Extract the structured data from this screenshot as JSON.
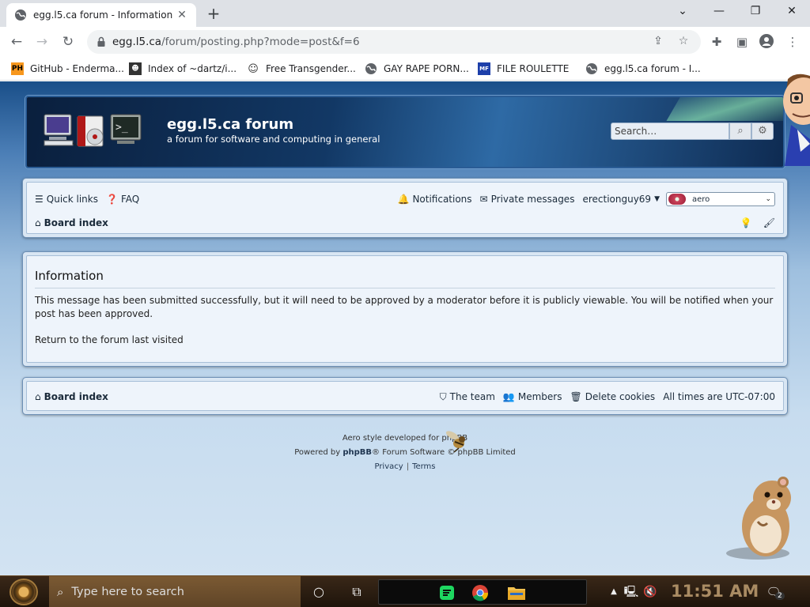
{
  "browser": {
    "tab_title": "egg.l5.ca forum - Information",
    "url_host": "egg.l5.ca",
    "url_path": "/forum/posting.php?mode=post&f=6",
    "bookmarks": [
      {
        "label": "GitHub - Enderma...",
        "icon": "PH"
      },
      {
        "label": "Index of ~dartz/i...",
        "icon": "cat"
      },
      {
        "label": "Free Transgender...",
        "icon": "mask"
      },
      {
        "label": "GAY RAPE PORN...",
        "icon": "globe"
      },
      {
        "label": "FILE ROULETTE",
        "icon": "MF"
      },
      {
        "label": "egg.l5.ca forum - I...",
        "icon": "globe"
      }
    ]
  },
  "header": {
    "site_name": "egg.l5.ca forum",
    "site_desc": "a forum for software and computing in general",
    "search_placeholder": "Search…"
  },
  "nav": {
    "quick_links": "Quick links",
    "faq": "FAQ",
    "notifications": "Notifications",
    "private_messages": "Private messages",
    "username": "erectionguy69",
    "style_selected": "aero",
    "board_index": "Board index"
  },
  "info": {
    "title": "Information",
    "message": "This message has been submitted successfully, but it will need to be approved by a moderator before it is publicly viewable. You will be notified when your post has been approved.",
    "return_link": "Return to the forum last visited"
  },
  "footer": {
    "board_index": "Board index",
    "the_team": "The team",
    "members": "Members",
    "delete_cookies": "Delete cookies",
    "timezone_label": "All times are",
    "timezone_value": "UTC-07:00",
    "credit_style": "Aero style developed for phpBB",
    "powered_prefix": "Powered by",
    "powered_brand": "phpBB",
    "powered_suffix": "® Forum Software © phpBB Limited",
    "privacy": "Privacy",
    "terms": "Terms"
  },
  "taskbar": {
    "search_placeholder": "Type here to search",
    "clock": "11:51 AM",
    "notification_count": "2"
  }
}
